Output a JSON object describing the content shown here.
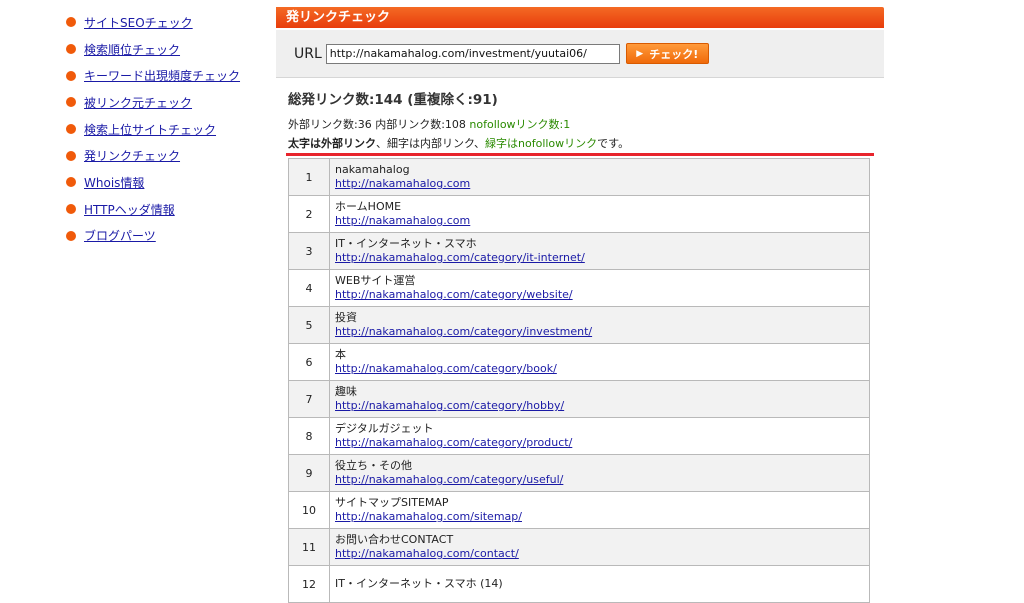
{
  "sidebar": {
    "items": [
      {
        "label": "サイトSEOチェック"
      },
      {
        "label": "検索順位チェック"
      },
      {
        "label": "キーワード出現頻度チェック"
      },
      {
        "label": "被リンク元チェック"
      },
      {
        "label": "検索上位サイトチェック"
      },
      {
        "label": "発リンクチェック"
      },
      {
        "label": "Whois情報"
      },
      {
        "label": "HTTPヘッダ情報"
      },
      {
        "label": "ブログパーツ"
      }
    ]
  },
  "main": {
    "title": "発リンクチェック",
    "url_label": "URL",
    "url_value": "http://nakamahalog.com/investment/yuutai06/",
    "check_button": "チェック!",
    "total": "総発リンク数:144 (重複除く:91)",
    "counts_prefix": "外部リンク数:36  内部リンク数:108",
    "counts_nofollow": "nofollowリンク数:1",
    "legend_bold": "太字は外部リンク",
    "legend_mid": "、細字は内部リンク、",
    "legend_green": "緑字はnofollowリンク",
    "legend_end": "です。"
  },
  "links": [
    {
      "num": "1",
      "title": "nakamahalog",
      "url": "http://nakamahalog.com"
    },
    {
      "num": "2",
      "title": "ホームHOME",
      "url": "http://nakamahalog.com"
    },
    {
      "num": "3",
      "title": "IT・インターネット・スマホ",
      "url": "http://nakamahalog.com/category/it-internet/"
    },
    {
      "num": "4",
      "title": "WEBサイト運営",
      "url": "http://nakamahalog.com/category/website/"
    },
    {
      "num": "5",
      "title": "投資",
      "url": "http://nakamahalog.com/category/investment/"
    },
    {
      "num": "6",
      "title": "本",
      "url": "http://nakamahalog.com/category/book/"
    },
    {
      "num": "7",
      "title": "趣味",
      "url": "http://nakamahalog.com/category/hobby/"
    },
    {
      "num": "8",
      "title": "デジタルガジェット",
      "url": "http://nakamahalog.com/category/product/"
    },
    {
      "num": "9",
      "title": "役立ち・その他",
      "url": "http://nakamahalog.com/category/useful/"
    },
    {
      "num": "10",
      "title": "サイトマップSITEMAP",
      "url": "http://nakamahalog.com/sitemap/"
    },
    {
      "num": "11",
      "title": "お問い合わせCONTACT",
      "url": "http://nakamahalog.com/contact/"
    },
    {
      "num": "12",
      "title": "IT・インターネット・スマホ (14)",
      "url": ""
    }
  ]
}
